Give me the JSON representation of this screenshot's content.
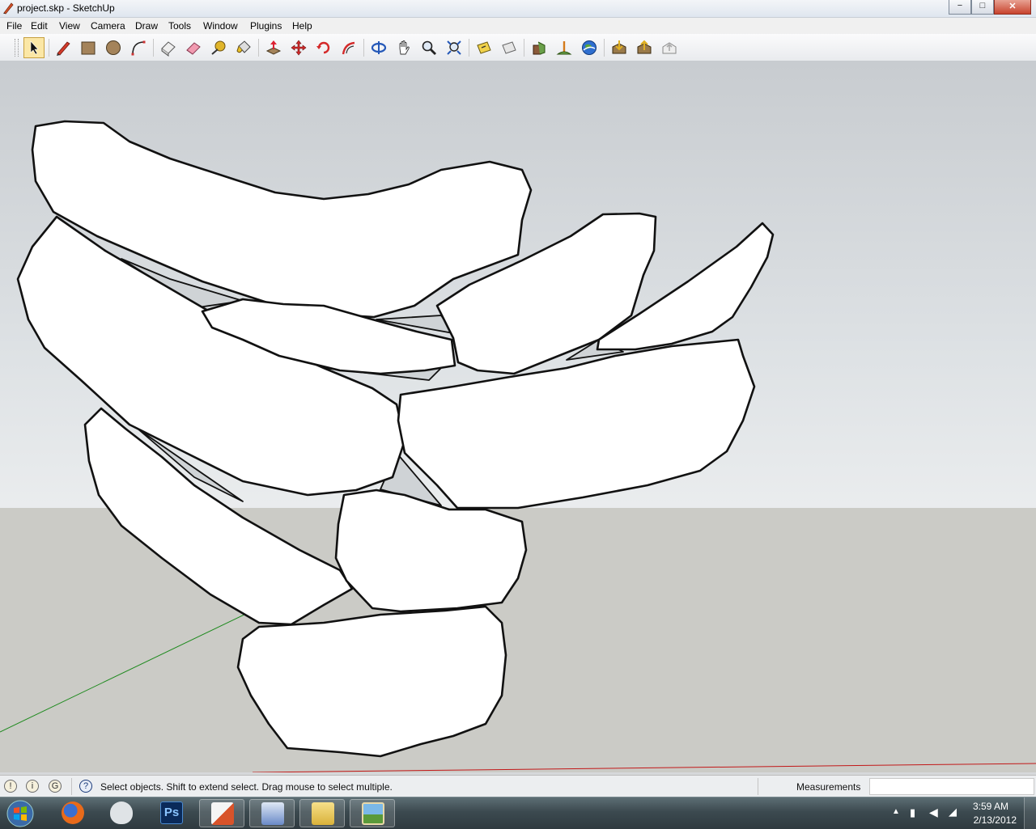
{
  "window": {
    "title": "project.skp - SketchUp",
    "controls": {
      "minimize": "−",
      "maximize": "□",
      "close": "✕"
    }
  },
  "menu": [
    "File",
    "Edit",
    "View",
    "Camera",
    "Draw",
    "Tools",
    "Window",
    "Plugins",
    "Help"
  ],
  "toolbar": {
    "tools": [
      {
        "name": "select-tool",
        "icon": "arrow-icon",
        "active": true
      },
      {
        "name": "line-tool",
        "icon": "pencil-icon"
      },
      {
        "name": "rectangle-tool",
        "icon": "rectangle-icon"
      },
      {
        "name": "circle-tool",
        "icon": "circle-icon"
      },
      {
        "name": "arc-tool",
        "icon": "arc-icon"
      },
      {
        "name": "make-component-tool",
        "icon": "component-icon"
      },
      {
        "name": "eraser-tool",
        "icon": "eraser-icon"
      },
      {
        "name": "tape-measure-tool",
        "icon": "tape-measure-icon"
      },
      {
        "name": "paint-bucket-tool",
        "icon": "paint-bucket-icon"
      },
      {
        "name": "push-pull-tool",
        "icon": "push-pull-icon"
      },
      {
        "name": "move-tool",
        "icon": "move-icon"
      },
      {
        "name": "rotate-tool",
        "icon": "rotate-icon"
      },
      {
        "name": "follow-me-tool",
        "icon": "follow-me-icon"
      },
      {
        "name": "orbit-tool",
        "icon": "orbit-icon"
      },
      {
        "name": "pan-tool",
        "icon": "hand-icon"
      },
      {
        "name": "zoom-tool",
        "icon": "magnifier-icon"
      },
      {
        "name": "zoom-extents-tool",
        "icon": "zoom-extents-icon"
      },
      {
        "name": "previous-view-tool",
        "icon": "folder-view-icon"
      },
      {
        "name": "next-view-tool",
        "icon": "view-icon"
      },
      {
        "name": "add-location-tool",
        "icon": "location-icon"
      },
      {
        "name": "toggle-terrain-tool",
        "icon": "terrain-icon"
      },
      {
        "name": "google-earth-tool",
        "icon": "globe-icon"
      },
      {
        "name": "get-models-tool",
        "icon": "warehouse-down-icon"
      },
      {
        "name": "share-model-tool",
        "icon": "warehouse-up-icon"
      },
      {
        "name": "share-component-tool",
        "icon": "component-share-icon"
      }
    ]
  },
  "statusbar": {
    "message": "Select objects. Shift to extend select. Drag mouse to select multiple.",
    "measurements_label": "Measurements",
    "measurements_value": ""
  },
  "taskbar": {
    "apps": [
      {
        "name": "firefox",
        "icon": "firefox-icon"
      },
      {
        "name": "alien",
        "icon": "alien-icon"
      },
      {
        "name": "photoshop",
        "icon": "photoshop-icon",
        "label": "Ps"
      },
      {
        "name": "sketchup",
        "icon": "sketchup-icon"
      },
      {
        "name": "display",
        "icon": "display-icon"
      },
      {
        "name": "explorer",
        "icon": "folder-icon"
      },
      {
        "name": "photo-viewer",
        "icon": "picture-icon"
      }
    ],
    "clock_time": "3:59 AM",
    "clock_date": "2/13/2012"
  },
  "colors": {
    "sky_top": "#c8ccd0",
    "ground": "#cbcbc6",
    "accent": "#fbe7a6"
  }
}
